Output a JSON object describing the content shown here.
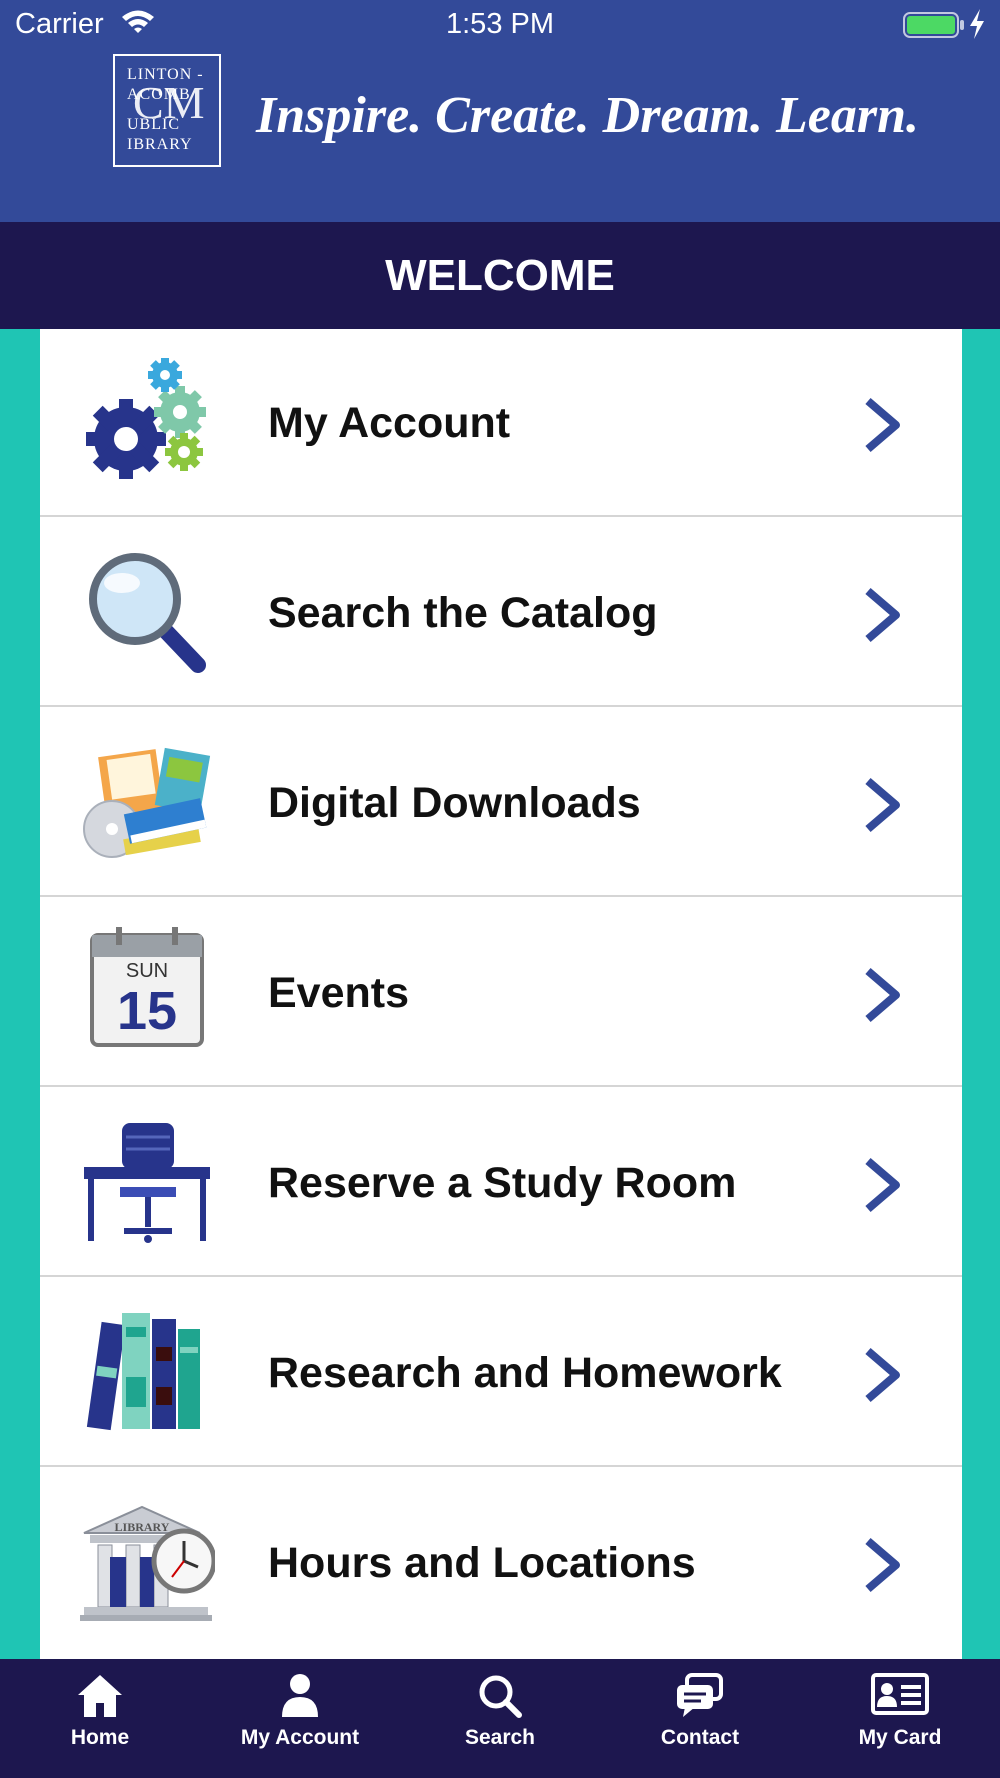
{
  "status_bar": {
    "carrier": "Carrier",
    "time": "1:53 PM",
    "battery_color": "#4cd964"
  },
  "header": {
    "logo": {
      "line1": "LINTON -",
      "line2": "ACOMB",
      "line3": "UBLIC",
      "line4": "IBRARY",
      "monogram": "CM"
    },
    "tagline": "Inspire. Create. Dream. Learn.",
    "background_color": "#334a99"
  },
  "welcome": {
    "title": "WELCOME",
    "background_color": "#1d174f"
  },
  "menu": {
    "items": [
      {
        "label": "My Account",
        "icon": "gears-icon"
      },
      {
        "label": "Search the Catalog",
        "icon": "magnifier-icon"
      },
      {
        "label": "Digital Downloads",
        "icon": "books-disc-icon"
      },
      {
        "label": "Events",
        "icon": "calendar-icon",
        "calendar_day": "SUN",
        "calendar_date": "15"
      },
      {
        "label": "Reserve a Study Room",
        "icon": "desk-chair-icon"
      },
      {
        "label": "Research and Homework",
        "icon": "bookshelf-icon"
      },
      {
        "label": "Hours and Locations",
        "icon": "library-clock-icon",
        "building_text": "LIBRARY"
      }
    ],
    "chevron_color": "#334a99"
  },
  "tab_bar": {
    "tabs": [
      {
        "label": "Home",
        "icon": "home-icon"
      },
      {
        "label": "My Account",
        "icon": "person-icon"
      },
      {
        "label": "Search",
        "icon": "search-icon"
      },
      {
        "label": "Contact",
        "icon": "chat-icon"
      },
      {
        "label": "My Card",
        "icon": "card-icon"
      }
    ]
  },
  "colors": {
    "side_margin": "#1fc5b4",
    "tab_bar": "#1d174f"
  }
}
